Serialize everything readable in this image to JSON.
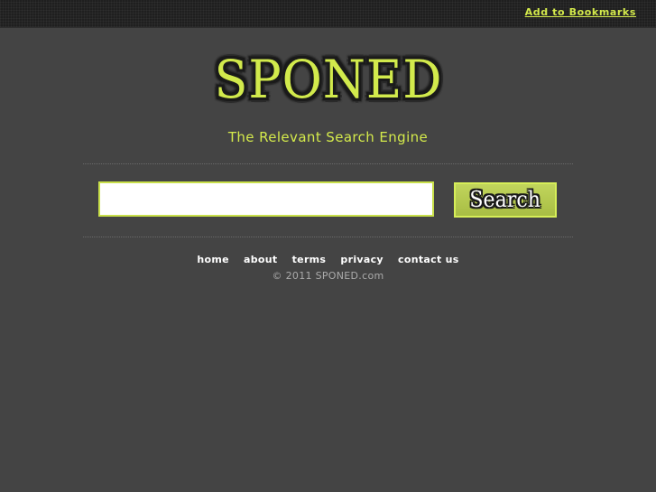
{
  "topbar": {
    "bookmark_label": "Add to Bookmarks"
  },
  "logo": {
    "text": "SPONED"
  },
  "tagline": "The Relevant Search Engine",
  "search": {
    "value": "",
    "button_label": "Search"
  },
  "footer": {
    "links": [
      "home",
      "about",
      "terms",
      "privacy",
      "contact us"
    ],
    "copyright": "© 2011 SPONED.com"
  },
  "colors": {
    "background": "#444444",
    "topbar": "#1f1f1f",
    "accent": "#d4ea4b",
    "button": "#b5ca50"
  }
}
